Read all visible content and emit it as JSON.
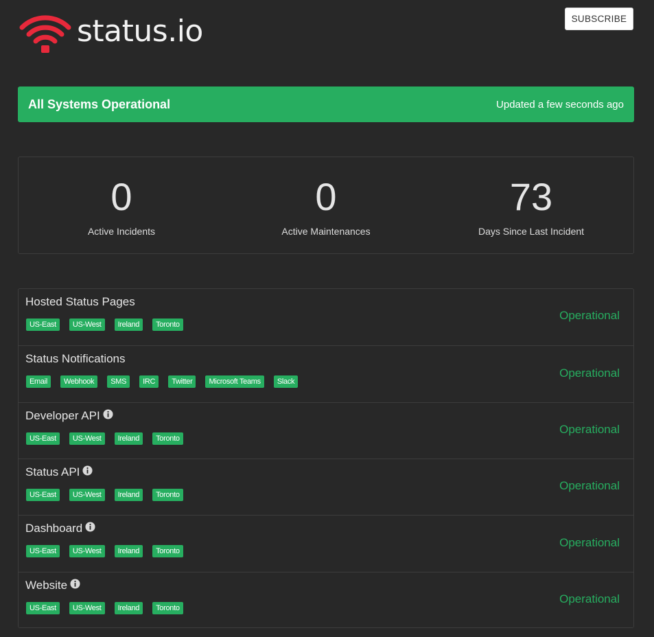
{
  "header": {
    "logo_text": "status.io",
    "subscribe_label": "SUBSCRIBE",
    "brand_color": "#e8293b"
  },
  "banner": {
    "title": "All Systems Operational",
    "updated": "Updated a few seconds ago",
    "color": "#27ae60"
  },
  "stats": [
    {
      "value": "0",
      "label": "Active Incidents"
    },
    {
      "value": "0",
      "label": "Active Maintenances"
    },
    {
      "value": "73",
      "label": "Days Since Last Incident"
    }
  ],
  "components": [
    {
      "name": "Hosted Status Pages",
      "info": false,
      "status": "Operational",
      "tags": [
        "US-East",
        "US-West",
        "Ireland",
        "Toronto"
      ]
    },
    {
      "name": "Status Notifications",
      "info": false,
      "status": "Operational",
      "tags": [
        "Email",
        "Webhook",
        "SMS",
        "IRC",
        "Twitter",
        "Microsoft Teams",
        "Slack"
      ]
    },
    {
      "name": "Developer API",
      "info": true,
      "status": "Operational",
      "tags": [
        "US-East",
        "US-West",
        "Ireland",
        "Toronto"
      ]
    },
    {
      "name": "Status API",
      "info": true,
      "status": "Operational",
      "tags": [
        "US-East",
        "US-West",
        "Ireland",
        "Toronto"
      ]
    },
    {
      "name": "Dashboard",
      "info": true,
      "status": "Operational",
      "tags": [
        "US-East",
        "US-West",
        "Ireland",
        "Toronto"
      ]
    },
    {
      "name": "Website",
      "info": true,
      "status": "Operational",
      "tags": [
        "US-East",
        "US-West",
        "Ireland",
        "Toronto"
      ]
    }
  ]
}
